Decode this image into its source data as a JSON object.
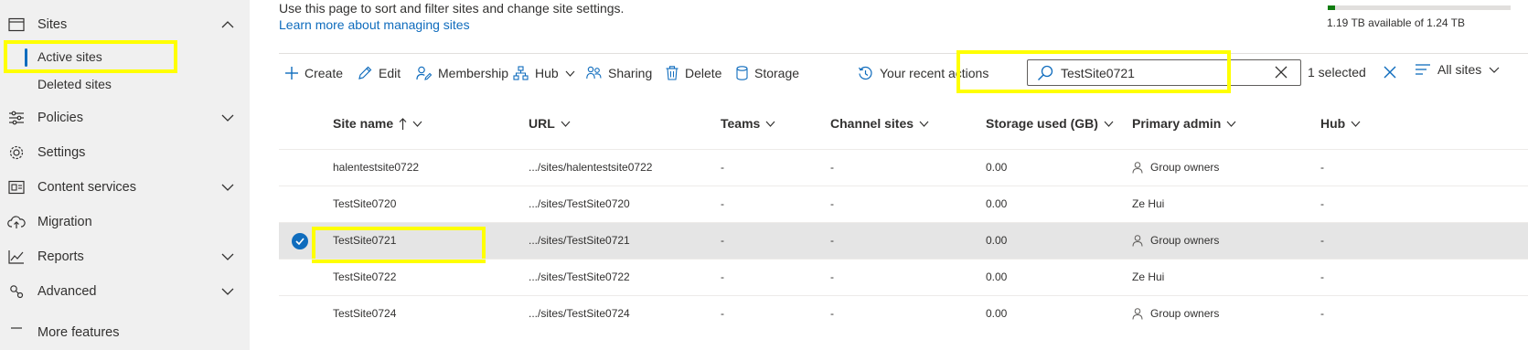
{
  "sidebar": {
    "sites_label": "Sites",
    "active_sites_label": "Active sites",
    "deleted_sites_label": "Deleted sites",
    "policies_label": "Policies",
    "settings_label": "Settings",
    "content_services_label": "Content services",
    "migration_label": "Migration",
    "reports_label": "Reports",
    "advanced_label": "Advanced",
    "more_features_label": "More features"
  },
  "header": {
    "intro": "Use this page to sort and filter sites and change site settings.",
    "learn_more": "Learn more about managing sites",
    "storage_text": "1.19 TB available of 1.24 TB",
    "storage_used_fraction": 0.04
  },
  "toolbar": {
    "create": "Create",
    "edit": "Edit",
    "membership": "Membership",
    "hub": "Hub",
    "sharing": "Sharing",
    "delete": "Delete",
    "storage": "Storage",
    "recent_actions": "Your recent actions",
    "search_value": "TestSite0721",
    "selected_count": "1 selected",
    "view_label": "All sites"
  },
  "table": {
    "columns": {
      "site_name": "Site name",
      "url": "URL",
      "teams": "Teams",
      "channel_sites": "Channel sites",
      "storage_used": "Storage used (GB)",
      "primary_admin": "Primary admin",
      "hub": "Hub"
    },
    "rows": [
      {
        "name": "halentestsite0722",
        "url": ".../sites/halentestsite0722",
        "teams": "-",
        "channel": "-",
        "storage": "0.00",
        "admin": "Group owners",
        "hub": "-"
      },
      {
        "name": "TestSite0720",
        "url": ".../sites/TestSite0720",
        "teams": "-",
        "channel": "-",
        "storage": "0.00",
        "admin": "Ze Hui",
        "hub": "-"
      },
      {
        "name": "TestSite0721",
        "url": ".../sites/TestSite0721",
        "teams": "-",
        "channel": "-",
        "storage": "0.00",
        "admin": "Group owners",
        "hub": "-"
      },
      {
        "name": "TestSite0722",
        "url": ".../sites/TestSite0722",
        "teams": "-",
        "channel": "-",
        "storage": "0.00",
        "admin": "Ze Hui",
        "hub": "-"
      },
      {
        "name": "TestSite0724",
        "url": ".../sites/TestSite0724",
        "teams": "-",
        "channel": "-",
        "storage": "0.00",
        "admin": "Group owners",
        "hub": "-"
      }
    ]
  },
  "colors": {
    "accent": "#0f6cbd",
    "highlight": "#ffff00",
    "storage_green": "#107c10",
    "sidebar_bg": "#f0f0f0",
    "selected_row": "#e5e5e5"
  }
}
